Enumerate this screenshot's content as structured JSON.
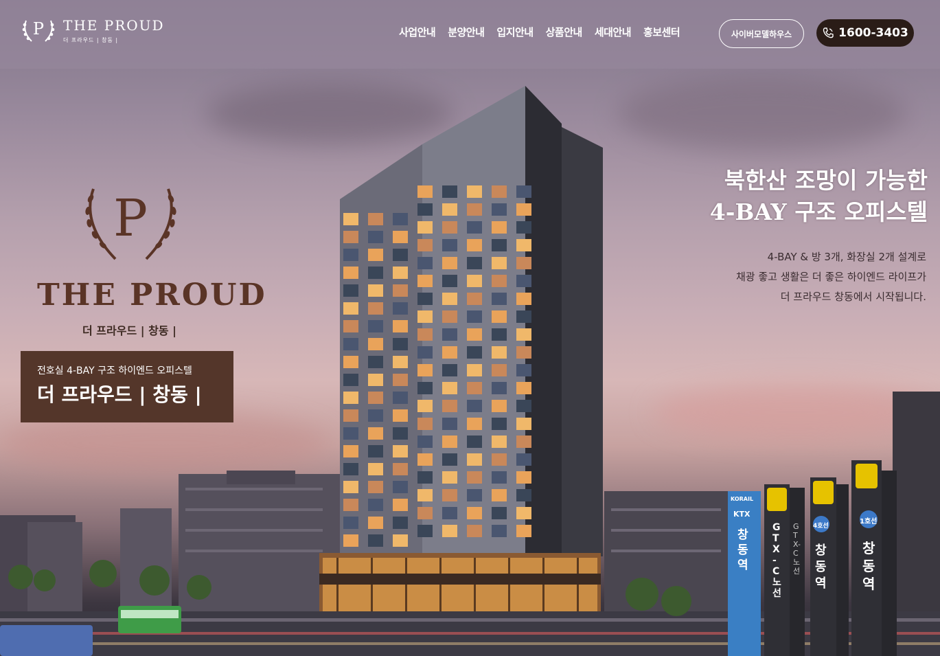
{
  "header": {
    "logo_title": "THE PROUD",
    "logo_subtitle": "더 프라우드 | 창동 |",
    "nav": [
      "사업안내",
      "분양안내",
      "입지안내",
      "상품안내",
      "세대안내",
      "홍보센터"
    ],
    "cyber_button": "사이버모델하우스",
    "phone": "1600-3403"
  },
  "brand": {
    "emblem_letter": "P",
    "name": "THE PROUD",
    "name_kr": "더 프라우드 | 창동 |"
  },
  "promo": {
    "subtitle": "전호실 4-BAY 구조 하이엔드 오피스텔",
    "title": "더 프라우드 | 창동 |"
  },
  "headline": {
    "line1": "북한산 조망이 가능한",
    "line2": "4-BAY 구조 오피스텔"
  },
  "description": {
    "line1": "4-BAY & 방 3개, 화장실 2개 설계로",
    "line2": "채광 좋고 생활은 더 좋은 하이엔드 라이프가",
    "line3": "더 프라우드 창동에서 시작됩니다."
  },
  "signs": {
    "korail": "KORAIL",
    "ktx": "KTX",
    "station1": "창동역",
    "gtx1": "GTX-C노선",
    "gtx2": "GTX-C노선",
    "line4": "4호선",
    "station2": "창동역",
    "line1": "1호선",
    "station3": "창동역"
  },
  "colors": {
    "brand_brown": "#54362a",
    "phone_bg": "#2a1c17",
    "sign_blue": "#3a7fc4",
    "sign_dark": "#2f2f35"
  }
}
